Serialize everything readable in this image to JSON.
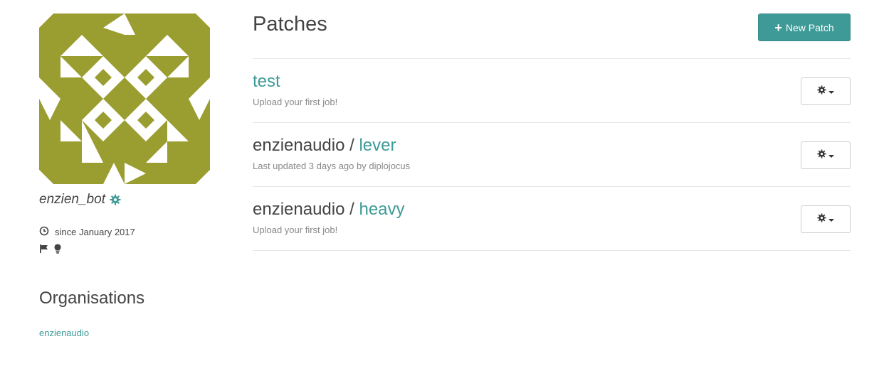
{
  "colors": {
    "accent": "#3d9a97",
    "avatar_bg": "#9a9d2f",
    "text": "#444444",
    "muted": "#888888",
    "divider": "#e5e5e5"
  },
  "profile": {
    "username": "enzien_bot",
    "username_icon": "gear-icon",
    "since": "since January 2017",
    "since_icon": "clock-icon",
    "badges": [
      "flag-icon",
      "lightbulb-icon"
    ]
  },
  "organisations": {
    "heading": "Organisations",
    "items": [
      {
        "label": "enzienaudio"
      }
    ]
  },
  "main": {
    "title": "Patches",
    "new_patch_label": "New Patch",
    "patches": [
      {
        "owner": "",
        "separator": "",
        "name": "test",
        "subtitle": "Upload your first job!"
      },
      {
        "owner": "enzienaudio",
        "separator": " / ",
        "name": "lever",
        "subtitle": "Last updated 3 days ago by diplojocus"
      },
      {
        "owner": "enzienaudio",
        "separator": " / ",
        "name": "heavy",
        "subtitle": "Upload your first job!"
      }
    ]
  }
}
